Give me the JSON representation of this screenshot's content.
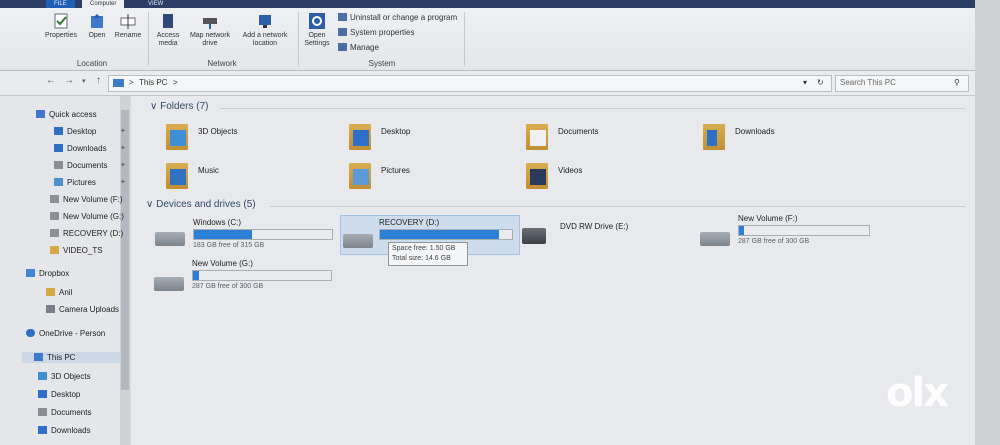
{
  "tabs": {
    "file": "FILE",
    "computer": "Computer",
    "view": "VIEW"
  },
  "ribbon": {
    "location": {
      "group_label": "Location",
      "properties": "Properties",
      "open": "Open",
      "rename": "Rename"
    },
    "network": {
      "group_label": "Network",
      "access_media": "Access media",
      "map_drive": "Map network drive",
      "add_location": "Add a network location"
    },
    "system": {
      "group_label": "System",
      "open_settings": "Open Settings",
      "uninstall": "Uninstall or change a program",
      "system_properties": "System properties",
      "manage": "Manage"
    }
  },
  "address": {
    "breadcrumb": "This PC",
    "sep": ">",
    "search_placeholder": "Search This PC"
  },
  "nav": {
    "quick_access": "Quick access",
    "items": [
      "Desktop",
      "Downloads",
      "Documents",
      "Pictures",
      "New Volume (F:)",
      "New Volume (G:)",
      "RECOVERY (D:)",
      "VIDEO_TS"
    ],
    "dropbox": "Dropbox",
    "dropbox_items": [
      "Anil",
      "Camera Uploads"
    ],
    "onedrive": "OneDrive - Person",
    "this_pc": "This PC",
    "pc_items": [
      "3D Objects",
      "Desktop",
      "Documents",
      "Downloads"
    ]
  },
  "folders": {
    "header": "Folders (7)",
    "items": [
      "3D Objects",
      "Desktop",
      "Documents",
      "Downloads",
      "Music",
      "Pictures",
      "Videos"
    ]
  },
  "drives": {
    "header": "Devices and drives (5)",
    "items": [
      {
        "name": "Windows (C:)",
        "free": "183 GB free of 315 GB",
        "used_fraction": 0.42
      },
      {
        "name": "RECOVERY (D:)",
        "free": "",
        "used_fraction": 0.9
      },
      {
        "name": "DVD RW Drive (E:)",
        "free": ""
      },
      {
        "name": "New Volume (F:)",
        "free": "287 GB free of 300 GB",
        "used_fraction": 0.04
      },
      {
        "name": "New Volume (G:)",
        "free": "287 GB free of 300 GB",
        "used_fraction": 0.04
      }
    ]
  },
  "tooltip": {
    "line1": "Space free: 1.50 GB",
    "line2": "Total size: 14.6 GB"
  },
  "watermark": "olx"
}
